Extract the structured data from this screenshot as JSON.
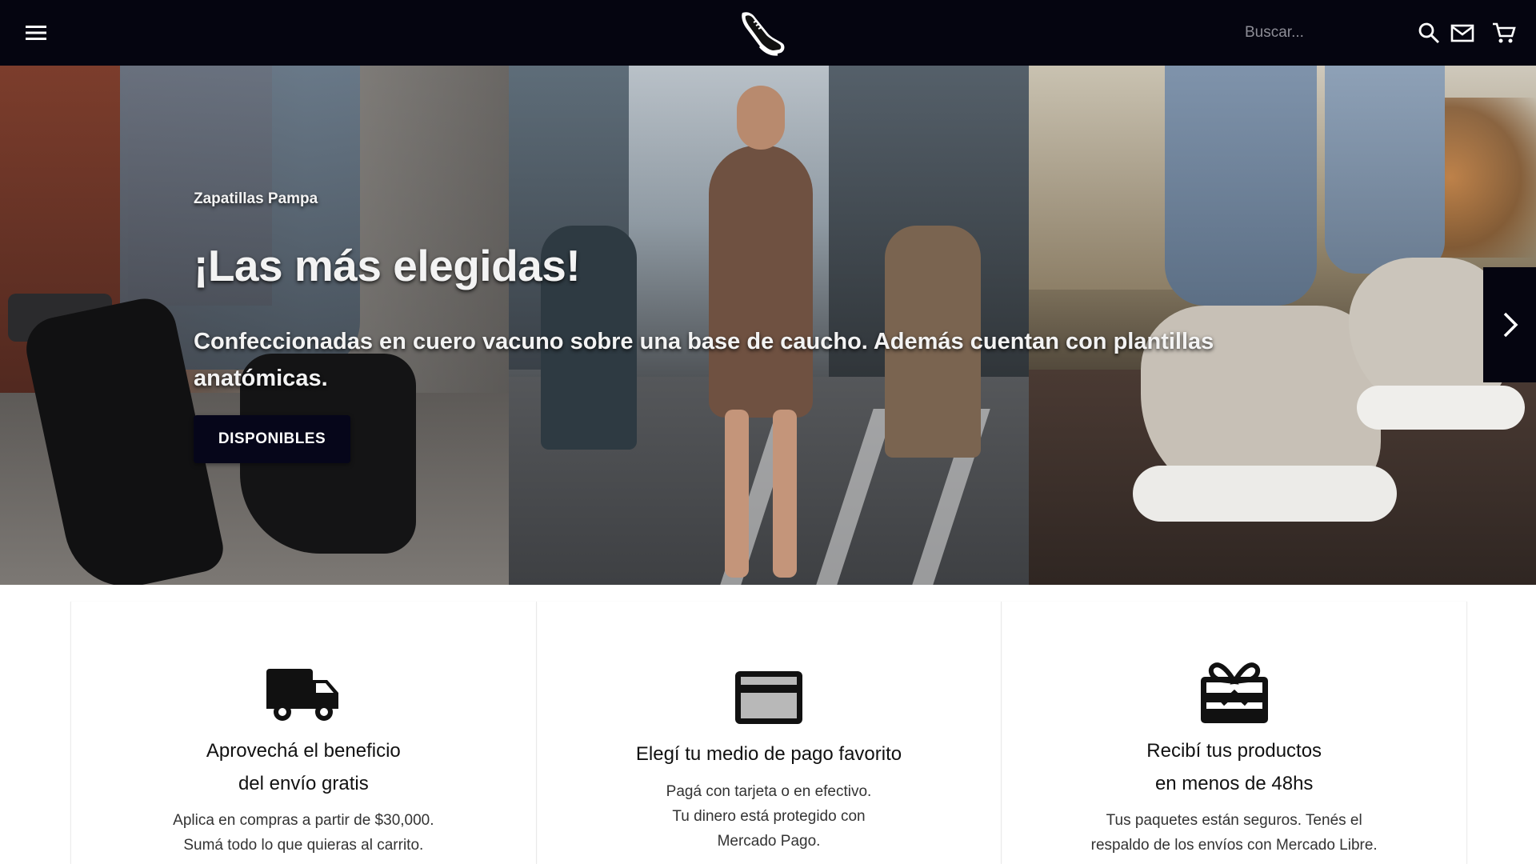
{
  "header": {
    "menu_icon": "hamburger-menu-icon",
    "logo_icon": "sneaker-logo-icon",
    "search_placeholder": "Buscar...",
    "icons": [
      "search-icon",
      "mail-icon",
      "cart-icon"
    ],
    "background": "#050510"
  },
  "hero": {
    "kicker": "Zapatillas Pampa",
    "headline": "¡Las más elegidas!",
    "subline": "Confeccionadas en cuero vacuno sobre una base de caucho. Además cuentan con plantillas anatómicas.",
    "cta_label": "DISPONIBLES",
    "next_icon": "chevron-right-icon",
    "cta_color": "#06061a"
  },
  "benefits": [
    {
      "icon": "truck-icon",
      "title_line1": "Aprovechá el beneficio",
      "title_line2": "del envío gratis",
      "text_line1": "Aplica en compras a partir de $30,000.",
      "text_line2": "Sumá todo lo que quieras al carrito."
    },
    {
      "icon": "credit-card-icon",
      "title_line1": "Elegí tu medio de pago favorito",
      "text_line1": "Pagá con tarjeta o en efectivo.",
      "text_line2": "Tu dinero está protegido con",
      "text_line3": "Mercado Pago."
    },
    {
      "icon": "gift-card-icon",
      "title_line1": "Recibí tus productos",
      "title_line2": "en menos de 48hs",
      "text_line1": "Tus paquetes están seguros. Tenés el",
      "text_line2": "respaldo de los envíos con Mercado Libre."
    }
  ]
}
